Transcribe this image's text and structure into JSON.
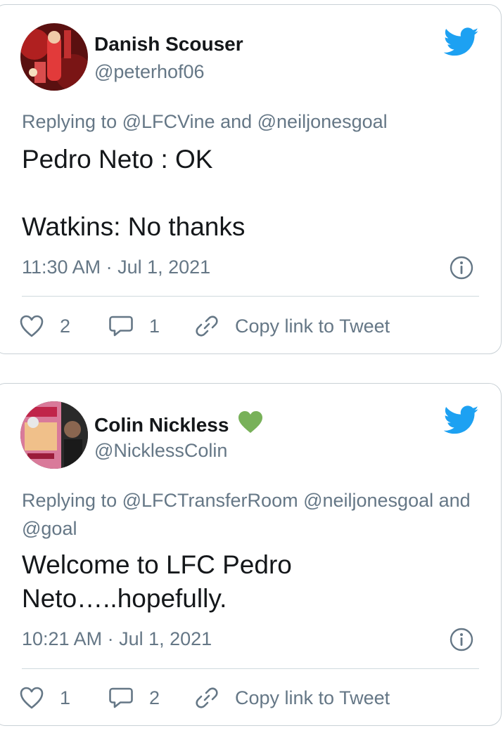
{
  "colors": {
    "twitter_blue": "#1da1f2",
    "secondary_text": "#657786",
    "primary_text": "#14171a",
    "heart_emoji": "#78b159"
  },
  "tweets": [
    {
      "display_name": "Danish Scouser",
      "handle": "@peterhof06",
      "reply_prefix": "Replying to",
      "reply_targets": "@LFCVine and @neiljonesgoal",
      "text": "Pedro Neto : OK\n\nWatkins: No thanks",
      "timestamp": "11:30 AM · Jul 1, 2021",
      "likes": "2",
      "replies": "1",
      "copy_link_label": "Copy link to Tweet",
      "icons": [
        "twitter-bird-icon",
        "info-icon",
        "heart-icon",
        "reply-bubble-icon",
        "link-icon"
      ]
    },
    {
      "display_name": "Colin Nickless",
      "name_emoji": "green-heart",
      "handle": "@NicklessColin",
      "reply_prefix": "Replying to",
      "reply_targets": "@LFCTransferRoom @neiljonesgoal and @goal",
      "text": "Welcome to LFC Pedro Neto…..hopefully.",
      "timestamp": "10:21 AM · Jul 1, 2021",
      "likes": "1",
      "replies": "2",
      "copy_link_label": "Copy link to Tweet",
      "icons": [
        "twitter-bird-icon",
        "info-icon",
        "heart-icon",
        "reply-bubble-icon",
        "link-icon"
      ]
    }
  ]
}
